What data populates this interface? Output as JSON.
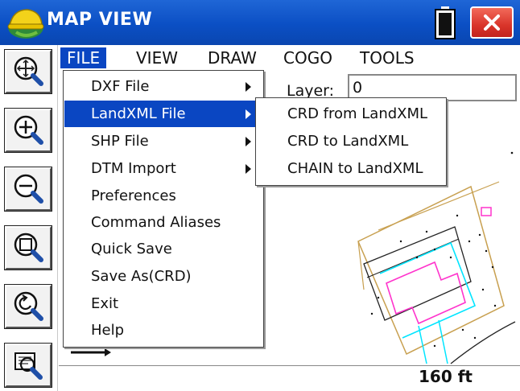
{
  "window": {
    "title": "MAP VIEW",
    "logo_icon": "hardhat-logo-icon",
    "battery_icon": "battery-icon",
    "close_icon": "close-icon"
  },
  "toolbar": {
    "tools": [
      {
        "icon": "zoom-extents-icon"
      },
      {
        "icon": "zoom-in-icon"
      },
      {
        "icon": "zoom-out-icon"
      },
      {
        "icon": "zoom-window-icon"
      },
      {
        "icon": "zoom-previous-icon"
      },
      {
        "icon": "screen-select-icon"
      }
    ]
  },
  "menubar": {
    "items": [
      "FILE",
      "VIEW",
      "DRAW",
      "COGO",
      "TOOLS"
    ],
    "active": "FILE"
  },
  "file_menu": {
    "items": [
      {
        "label": "DXF File",
        "submenu": true
      },
      {
        "label": "LandXML File",
        "submenu": true,
        "highlighted": true
      },
      {
        "label": "SHP File",
        "submenu": true
      },
      {
        "label": "DTM Import",
        "submenu": true
      },
      {
        "label": "Preferences",
        "submenu": false
      },
      {
        "label": "Command Aliases",
        "submenu": false
      },
      {
        "label": "Quick Save",
        "submenu": false
      },
      {
        "label": "Save As(CRD)",
        "submenu": false
      },
      {
        "label": "Exit",
        "submenu": false
      },
      {
        "label": "Help",
        "submenu": false
      }
    ]
  },
  "landxml_submenu": {
    "items": [
      "CRD from LandXML",
      "CRD to LandXML",
      "CHAIN to LandXML"
    ]
  },
  "map": {
    "layer_label": "Layer:",
    "layer_value": "0"
  },
  "status": {
    "scale": "160 ft"
  },
  "colors": {
    "title_bar": "#0b4fc4",
    "highlight": "#0a46c2",
    "close_button": "#d9342a",
    "linework_cyan": "#00e5ff",
    "linework_magenta": "#ff33cc",
    "linework_tan": "#c8a050"
  }
}
